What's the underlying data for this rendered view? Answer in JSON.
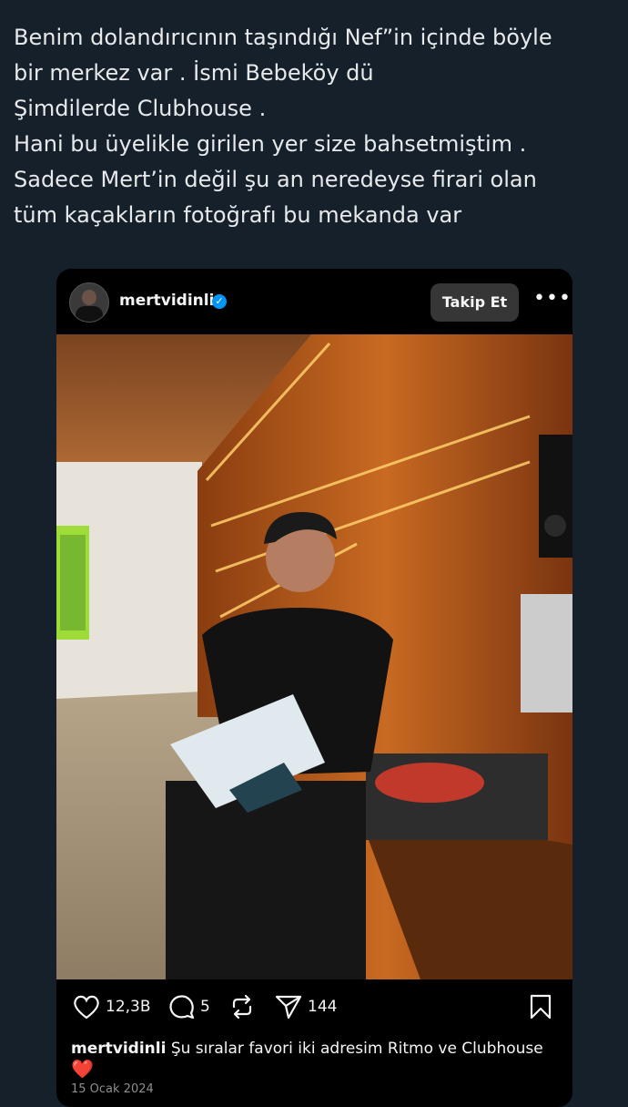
{
  "tweet": {
    "lines": [
      "Benim dolandırıcının taşındığı Nef”in  içinde böyle",
      "bir merkez var . İsmi Bebeköy dü",
      "Şimdilerde Clubhouse .",
      "Hani bu üyelikle girilen yer size bahsetmiştim .",
      "Sadece Mert’in değil şu an neredeyse firari olan",
      "tüm kaçakların fotoğrafı bu mekanda var"
    ]
  },
  "post": {
    "username": "mertvidinli",
    "follow_label": "Takip Et",
    "likes": "12,3B",
    "comments": "5",
    "shares": "144",
    "caption_user": "mertvidinli",
    "caption_text": "Şu sıralar favori iki adresim Ritmo ve Clubhouse",
    "caption_emoji": "❤️",
    "date": "15 Ocak 2024"
  },
  "colors": {
    "background": "#15202b",
    "text": "#e7e9ea",
    "embed_bg": "#000000",
    "verified": "#0095f6",
    "follow_btn": "#363636"
  }
}
